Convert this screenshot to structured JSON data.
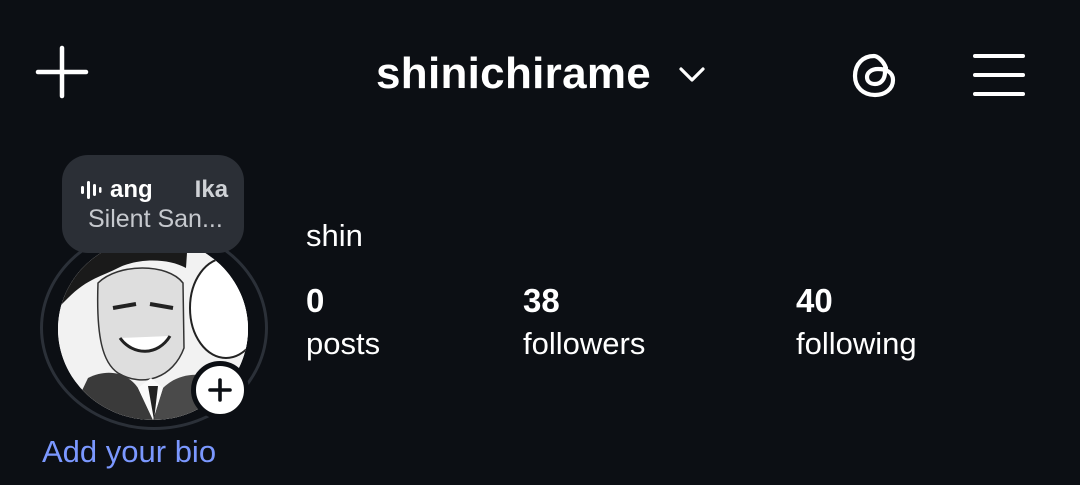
{
  "header": {
    "username": "shinichirame",
    "new_icon": "plus-icon",
    "switch_icon": "chevron-down-icon",
    "threads_icon": "threads-icon",
    "menu_icon": "hamburger-menu-icon"
  },
  "note": {
    "icon": "audio-wave-icon",
    "line1_a": "ang",
    "line1_b": "Ika",
    "line2": "Silent San..."
  },
  "profile": {
    "display_name": "shin",
    "stats": [
      {
        "value": "0",
        "label": "posts"
      },
      {
        "value": "38",
        "label": "followers"
      },
      {
        "value": "40",
        "label": "following"
      }
    ],
    "bio_link": "Add your bio"
  },
  "colors": {
    "background": "#0c0f14",
    "accent_link": "#7b98ff",
    "bubble": "#2b2f36"
  }
}
